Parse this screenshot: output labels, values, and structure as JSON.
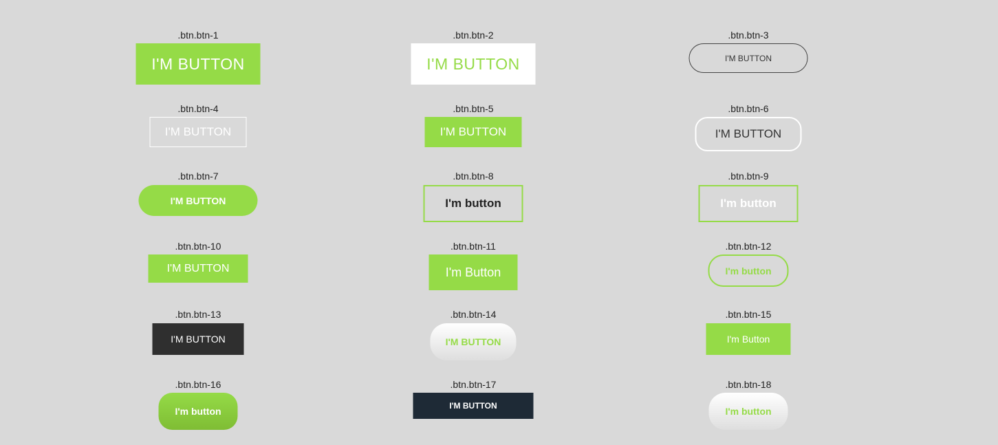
{
  "buttons": [
    {
      "label": ".btn.btn-1",
      "text": "I'M BUTTON"
    },
    {
      "label": ".btn.btn-2",
      "text": "I'M BUTTON"
    },
    {
      "label": ".btn.btn-3",
      "text": "I'M BUTTON"
    },
    {
      "label": ".btn.btn-4",
      "text": "I'M BUTTON"
    },
    {
      "label": ".btn.btn-5",
      "text": "I'M BUTTON"
    },
    {
      "label": ".btn.btn-6",
      "text": "I'M BUTTON"
    },
    {
      "label": ".btn.btn-7",
      "text": "I'M BUTTON"
    },
    {
      "label": ".btn.btn-8",
      "text": "I'm button"
    },
    {
      "label": ".btn.btn-9",
      "text": "I'm button"
    },
    {
      "label": ".btn.btn-10",
      "text": "I'M BUTTON"
    },
    {
      "label": ".btn.btn-11",
      "text": "I'm Button"
    },
    {
      "label": ".btn.btn-12",
      "text": "I'm button"
    },
    {
      "label": ".btn.btn-13",
      "text": "I'M BUTTON"
    },
    {
      "label": ".btn.btn-14",
      "text": "I'M BUTTON"
    },
    {
      "label": ".btn.btn-15",
      "text": "I'm Button"
    },
    {
      "label": ".btn.btn-16",
      "text": "I'm button"
    },
    {
      "label": ".btn.btn-17",
      "text": "I'M BUTTON"
    },
    {
      "label": ".btn.btn-18",
      "text": "I'm button"
    }
  ],
  "colors": {
    "background": "#d9d9d9",
    "accent": "#95db47",
    "dark": "#2f2f2f",
    "navy": "#1e2a36",
    "white": "#ffffff"
  }
}
